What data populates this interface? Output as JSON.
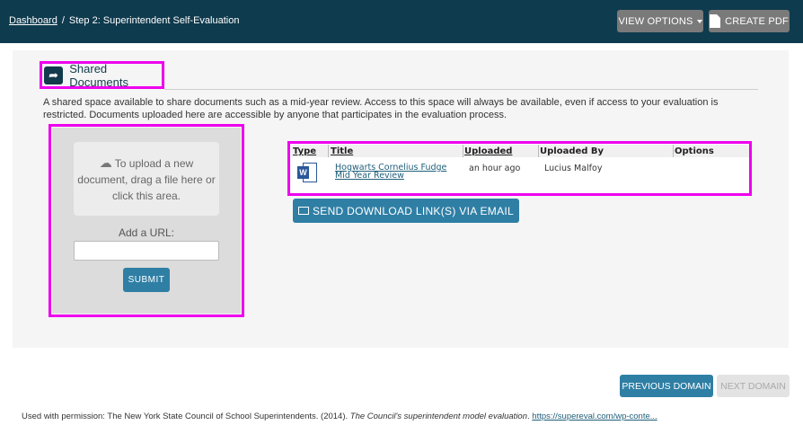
{
  "header": {
    "breadcrumb_home": "Dashboard",
    "breadcrumb_separator": "/",
    "breadcrumb_current": "Step 2: Superintendent Self-Evaluation",
    "view_options_label": "VIEW OPTIONS",
    "create_pdf_label": "CREATE PDF"
  },
  "section": {
    "title": "Shared Documents",
    "description": "A shared space available to share documents such as a mid-year review. Access to this space will always be available, even if access to your evaluation is restricted. Documents uploaded here are accessible by anyone that participates in the evaluation process."
  },
  "upload": {
    "drop_text": "To upload a new document, drag a file here or click this area.",
    "url_label": "Add a URL:",
    "url_value": "",
    "submit_label": "SUBMIT"
  },
  "table": {
    "headers": {
      "type": "Type",
      "title": "Title",
      "uploaded": "Uploaded",
      "uploaded_by": "Uploaded By",
      "options": "Options"
    },
    "rows": [
      {
        "type_icon": "word-document-icon",
        "title": "Hogwarts Cornelius Fudge Mid Year Review",
        "uploaded": "an hour ago",
        "uploaded_by": "Lucius Malfoy",
        "options": ""
      }
    ]
  },
  "email_button_label": "SEND DOWNLOAD LINK(S) VIA EMAIL",
  "nav": {
    "previous_label": "PREVIOUS DOMAIN",
    "next_label": "NEXT DOMAIN"
  },
  "citation": {
    "prefix": "Used with permission: The New York State Council of School Superintendents. (2014).",
    "italic": "The Council's superintendent model evaluation",
    "link": "https://supereval.com/wp-conte..."
  },
  "colors": {
    "header_bg": "#0f3b4e",
    "accent": "#2f7fa5",
    "highlight": "#ee00ee"
  }
}
